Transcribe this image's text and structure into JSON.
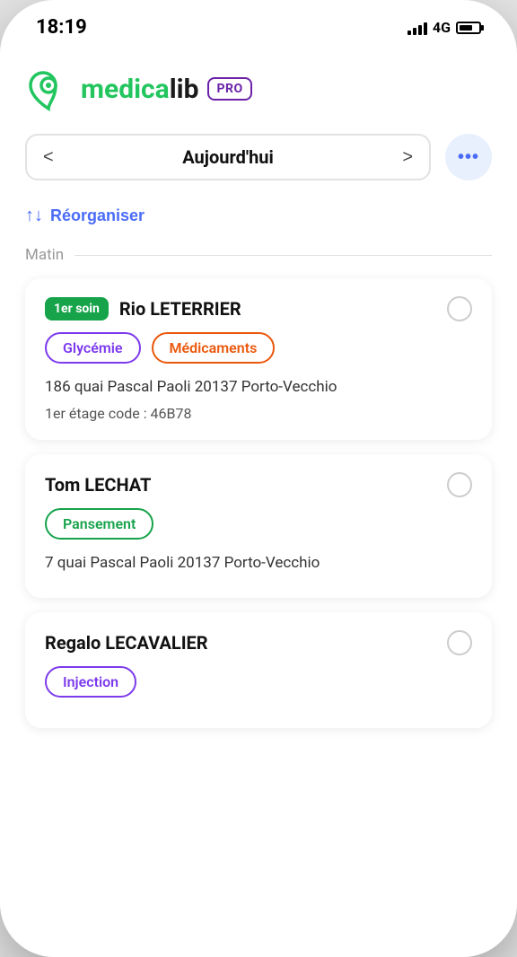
{
  "statusBar": {
    "time": "18:19",
    "network": "4G"
  },
  "header": {
    "logoText": "medicalib",
    "proBadge": "PRO"
  },
  "dateNav": {
    "prevArrow": "<",
    "nextArrow": ">",
    "label": "Aujourd'hui"
  },
  "menuButton": "•••",
  "reorganize": {
    "icon": "↑↓",
    "label": "Réorganiser"
  },
  "section": {
    "morning": "Matin"
  },
  "patients": [
    {
      "badge": "1er soin",
      "name": "Rio LETERRIER",
      "tags": [
        {
          "label": "Glycémie",
          "style": "purple"
        },
        {
          "label": "Médicaments",
          "style": "orange"
        }
      ],
      "address": "186 quai Pascal Paoli 20137 Porto-Vecchio",
      "detail": "1er étage code : 46B78"
    },
    {
      "badge": null,
      "name": "Tom LECHAT",
      "tags": [
        {
          "label": "Pansement",
          "style": "green"
        }
      ],
      "address": "7 quai Pascal Paoli 20137 Porto-Vecchio",
      "detail": null
    },
    {
      "badge": null,
      "name": "Regalo LECAVALIER",
      "tags": [
        {
          "label": "Injection",
          "style": "violet"
        }
      ],
      "address": null,
      "detail": null
    }
  ],
  "colors": {
    "accent": "#4a6cf7",
    "green": "#16a34a",
    "purple": "#7c3aed",
    "orange": "#ea580c"
  }
}
